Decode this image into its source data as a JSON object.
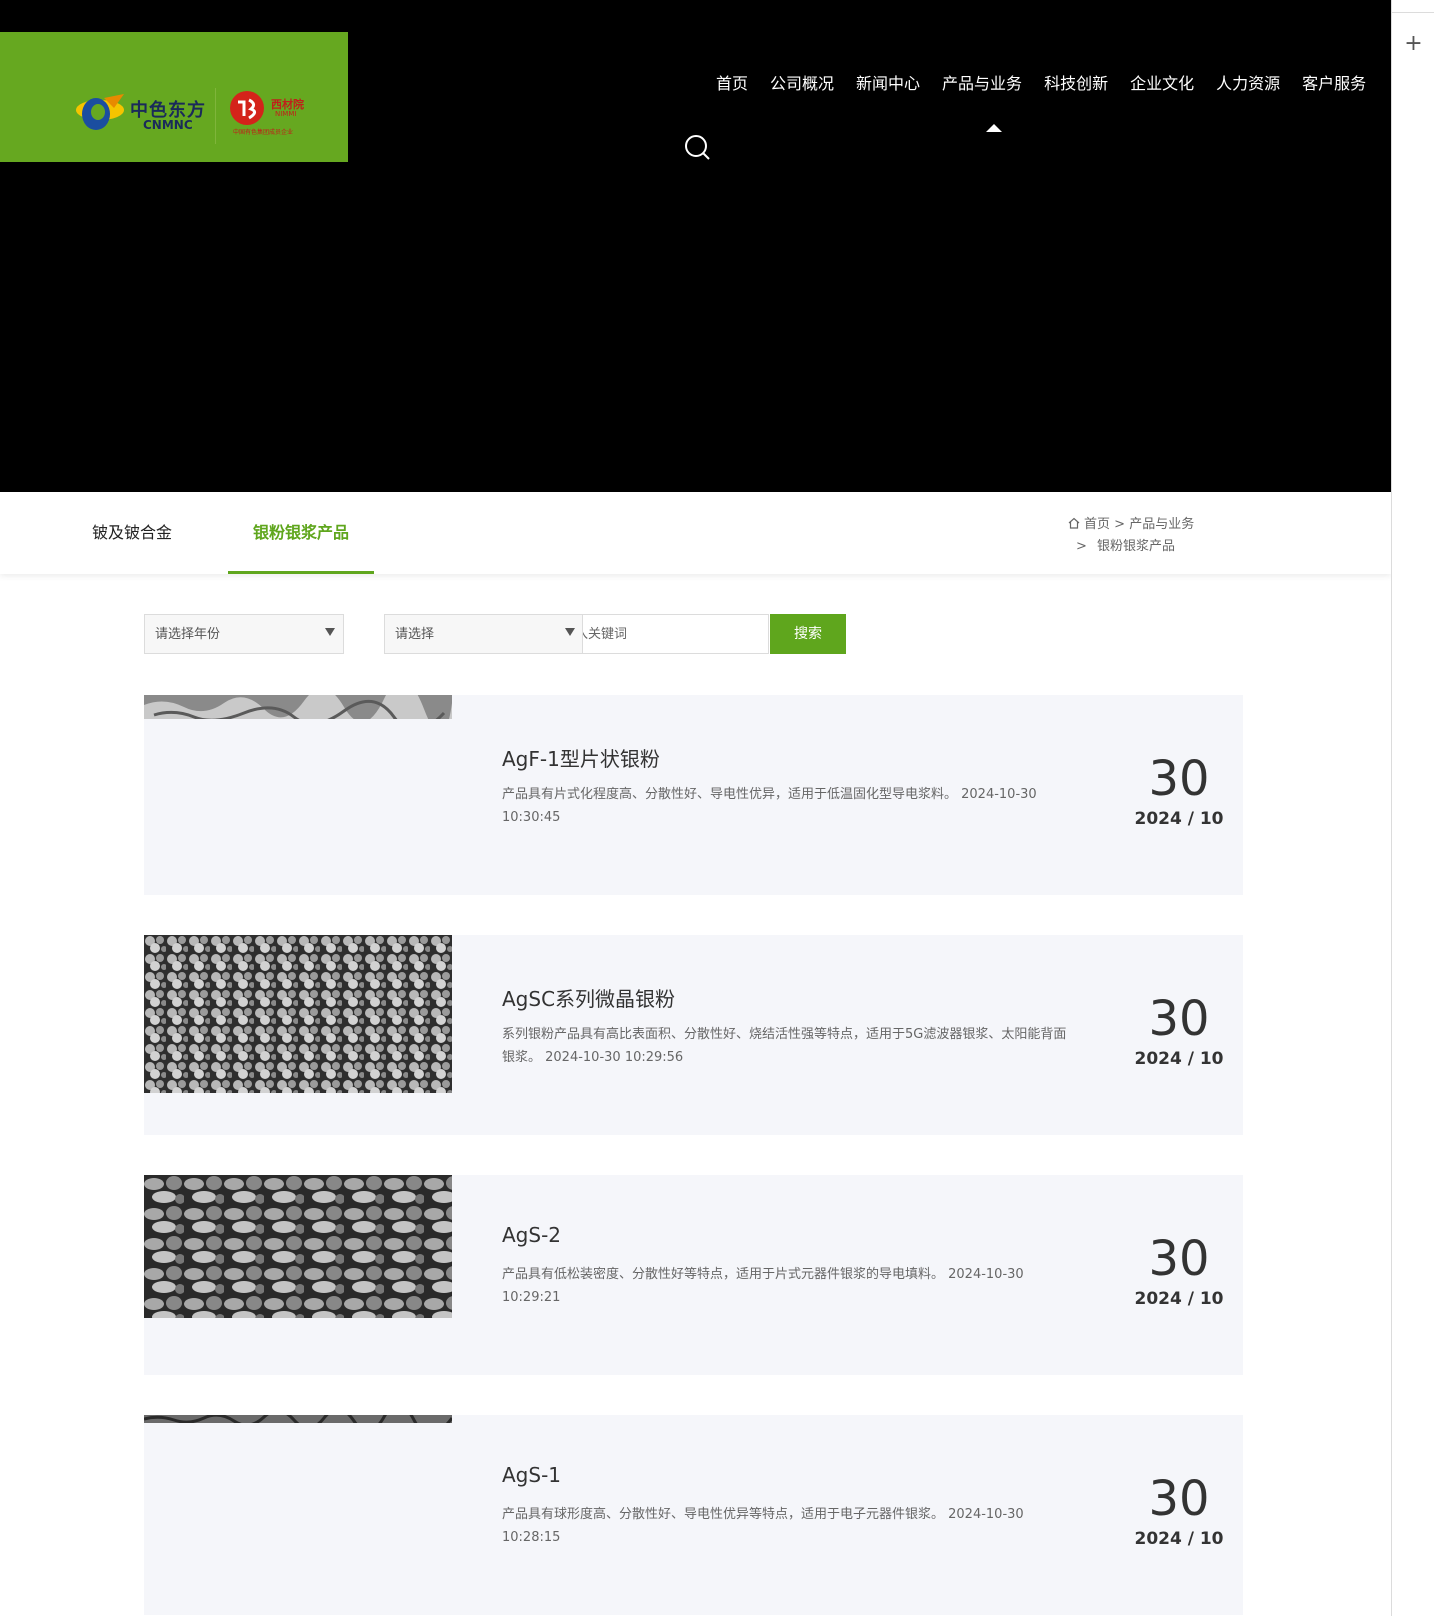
{
  "logo": {
    "cnmnc_cn": "中色东方",
    "cnmnc_en": "CNMNC",
    "nimmi_cn": "西材院",
    "nimmi_en": "NIMMI",
    "nimmi_sub": "中国有色集团成员企业"
  },
  "nav": {
    "items": [
      "首页",
      "公司概况",
      "新闻中心",
      "产品与业务",
      "科技创新",
      "企业文化",
      "人力资源",
      "客户服务"
    ],
    "active": "产品与业务"
  },
  "subnav": {
    "tab1": "铍及铍合金",
    "tab2": "银粉银浆产品"
  },
  "breadcrumb": {
    "home": "首页",
    "sep1": ">",
    "level2": "产品与业务",
    "sep2": ">",
    "level3": "银粉银浆产品"
  },
  "filters": {
    "year_select": "请选择年份",
    "type_select": "请选择",
    "keyword_placeholder": "请输入关键词",
    "keyword_visible": "入关键词",
    "search_button": "搜索"
  },
  "products": [
    {
      "title": "AgF-1型片状银粉",
      "desc": "产品具有片式化程度高、分散性好、导电性优异，适用于低温固化型导电浆料。 2024-10-30 10:30:45",
      "day": "30",
      "year_month": "2024 / 10"
    },
    {
      "title": "AgSC系列微晶银粉",
      "desc": "系列银粉产品具有高比表面积、分散性好、烧结活性强等特点，适用于5G滤波器银浆、太阳能背面银浆。 2024-10-30 10:29:56",
      "day": "30",
      "year_month": "2024 / 10"
    },
    {
      "title": "AgS-2",
      "desc": "产品具有低松装密度、分散性好等特点，适用于片式元器件银浆的导电填料。 2024-10-30 10:29:21",
      "day": "30",
      "year_month": "2024 / 10"
    },
    {
      "title": "AgS-1",
      "desc": "产品具有球形度高、分散性好、导电性优异等特点，适用于电子元器件银浆。 2024-10-30 10:28:15",
      "day": "30",
      "year_month": "2024 / 10"
    }
  ],
  "sidebar": {
    "expand_icon": "+"
  },
  "colors": {
    "brand_green": "#5fa61d",
    "logo_bg": "#66a820",
    "hero_bg": "#000000",
    "item_bg": "#f5f6fa"
  }
}
